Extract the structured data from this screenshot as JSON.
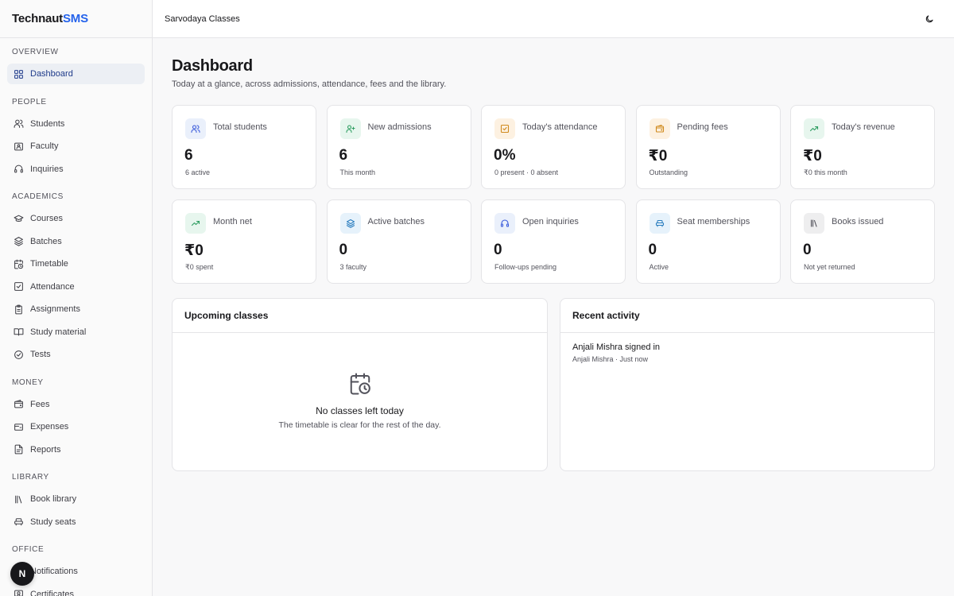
{
  "brand": {
    "part1": "Technaut",
    "part2": "SMS"
  },
  "org_name": "Sarvodaya Classes",
  "sidebar": {
    "sections": [
      {
        "label": "OVERVIEW",
        "items": [
          {
            "label": "Dashboard",
            "icon": "grid-icon",
            "active": true
          }
        ]
      },
      {
        "label": "PEOPLE",
        "items": [
          {
            "label": "Students",
            "icon": "users-icon"
          },
          {
            "label": "Faculty",
            "icon": "id-card-icon"
          },
          {
            "label": "Inquiries",
            "icon": "headset-icon"
          }
        ]
      },
      {
        "label": "ACADEMICS",
        "items": [
          {
            "label": "Courses",
            "icon": "graduation-cap-icon"
          },
          {
            "label": "Batches",
            "icon": "layers-icon"
          },
          {
            "label": "Timetable",
            "icon": "calendar-clock-icon"
          },
          {
            "label": "Attendance",
            "icon": "check-square-icon"
          },
          {
            "label": "Assignments",
            "icon": "clipboard-icon"
          },
          {
            "label": "Study material",
            "icon": "book-open-icon"
          },
          {
            "label": "Tests",
            "icon": "check-circle-icon"
          }
        ]
      },
      {
        "label": "MONEY",
        "items": [
          {
            "label": "Fees",
            "icon": "wallet-icon"
          },
          {
            "label": "Expenses",
            "icon": "receipt-icon"
          },
          {
            "label": "Reports",
            "icon": "file-text-icon"
          }
        ]
      },
      {
        "label": "LIBRARY",
        "items": [
          {
            "label": "Book library",
            "icon": "library-icon"
          },
          {
            "label": "Study seats",
            "icon": "armchair-icon"
          }
        ]
      },
      {
        "label": "OFFICE",
        "items": [
          {
            "label": "Notifications",
            "icon": "megaphone-icon"
          },
          {
            "label": "Certificates",
            "icon": "certificate-icon"
          }
        ]
      }
    ]
  },
  "page": {
    "title": "Dashboard",
    "subtitle": "Today at a glance, across admissions, attendance, fees and the library."
  },
  "cards": [
    {
      "label": "Total students",
      "value": "6",
      "sub": "6 active",
      "icon": "users-icon",
      "bg": "#eaf0fb",
      "fg": "#3b5bdb"
    },
    {
      "label": "New admissions",
      "value": "6",
      "sub": "This month",
      "icon": "user-plus-icon",
      "bg": "#e7f6ee",
      "fg": "#2f9e62"
    },
    {
      "label": "Today's attendance",
      "value": "0%",
      "sub": "0 present · 0 absent",
      "icon": "check-square-icon",
      "bg": "#fdf1e1",
      "fg": "#d08a1e"
    },
    {
      "label": "Pending fees",
      "value": "₹0",
      "sub": "Outstanding",
      "icon": "wallet-icon",
      "bg": "#fdf1e1",
      "fg": "#d08a1e"
    },
    {
      "label": "Today's revenue",
      "value": "₹0",
      "sub": "₹0 this month",
      "icon": "trending-up-icon",
      "bg": "#e7f6ee",
      "fg": "#2f9e62"
    },
    {
      "label": "Month net",
      "value": "₹0",
      "sub": "₹0 spent",
      "icon": "trending-up-icon",
      "bg": "#e7f6ee",
      "fg": "#2f9e62"
    },
    {
      "label": "Active batches",
      "value": "0",
      "sub": "3 faculty",
      "icon": "layers-icon",
      "bg": "#e6f2fb",
      "fg": "#2a7dbf"
    },
    {
      "label": "Open inquiries",
      "value": "0",
      "sub": "Follow-ups pending",
      "icon": "headset-icon",
      "bg": "#eaf0fb",
      "fg": "#3b5bdb"
    },
    {
      "label": "Seat memberships",
      "value": "0",
      "sub": "Active",
      "icon": "armchair-icon",
      "bg": "#e6f2fb",
      "fg": "#2a7dbf"
    },
    {
      "label": "Books issued",
      "value": "0",
      "sub": "Not yet returned",
      "icon": "library-icon",
      "bg": "#eeeeef",
      "fg": "#52525b"
    }
  ],
  "upcoming": {
    "title": "Upcoming classes",
    "empty_title": "No classes left today",
    "empty_sub": "The timetable is clear for the rest of the day."
  },
  "activity": {
    "title": "Recent activity",
    "items": [
      {
        "text": "Anjali Mishra signed in",
        "meta": "Anjali Mishra · Just now"
      }
    ]
  },
  "fab_label": "N"
}
